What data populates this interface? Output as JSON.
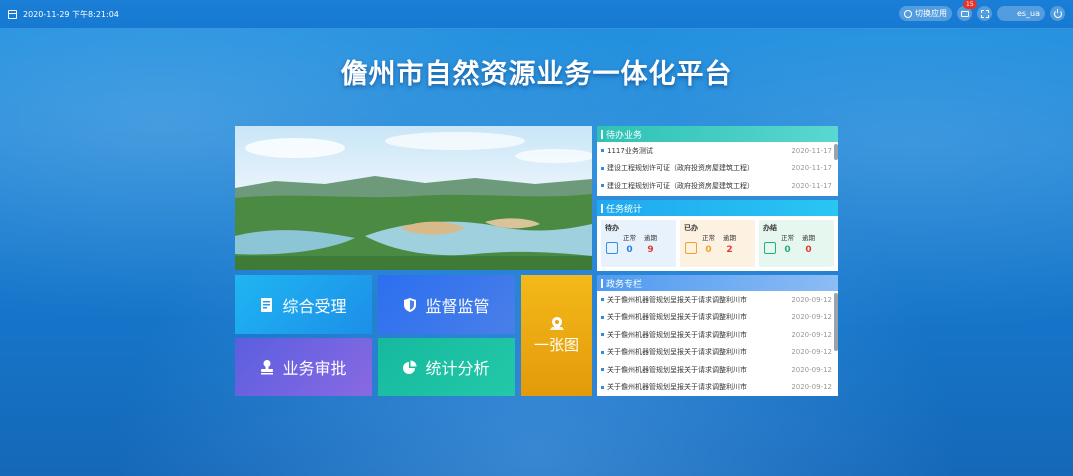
{
  "topbar": {
    "datetime": "2020-11-29 下午8:21:04",
    "switch_label": "切换应用",
    "badge_count": "15",
    "username": "es_ua"
  },
  "title": "儋州市自然资源业务一体化平台",
  "tiles": {
    "t1": "综合受理",
    "t2": "监督监管",
    "t3": "业务审批",
    "t4": "统计分析",
    "t5": "一张图"
  },
  "todo": {
    "title": "待办业务",
    "items": [
      {
        "text": "1117业务测试",
        "date": "2020-11-17"
      },
      {
        "text": "建设工程规划许可证（政府投资房屋建筑工程）",
        "date": "2020-11-17"
      },
      {
        "text": "建设工程规划许可证（政府投资房屋建筑工程）",
        "date": "2020-11-17"
      }
    ]
  },
  "tasks": {
    "title": "任务统计",
    "cards": [
      {
        "label": "待办",
        "normal_label": "正常",
        "over_label": "逾期",
        "normal": "0",
        "over": "9"
      },
      {
        "label": "已办",
        "normal_label": "正常",
        "over_label": "逾期",
        "normal": "0",
        "over": "2"
      },
      {
        "label": "办结",
        "normal_label": "正常",
        "over_label": "逾期",
        "normal": "0",
        "over": "0"
      }
    ]
  },
  "gov": {
    "title": "政务专栏",
    "items": [
      {
        "text": "关于儋州机器管规划呈报关于请求调整利川市",
        "date": "2020-09-12"
      },
      {
        "text": "关于儋州机器管规划呈报关于请求调整利川市",
        "date": "2020-09-12"
      },
      {
        "text": "关于儋州机器管规划呈报关于请求调整利川市",
        "date": "2020-09-12"
      },
      {
        "text": "关于儋州机器管规划呈报关于请求调整利川市",
        "date": "2020-09-12"
      },
      {
        "text": "关于儋州机器管规划呈报关于请求调整利川市",
        "date": "2020-09-12"
      },
      {
        "text": "关于儋州机器管规划呈报关于请求调整利川市",
        "date": "2020-09-12"
      }
    ]
  }
}
